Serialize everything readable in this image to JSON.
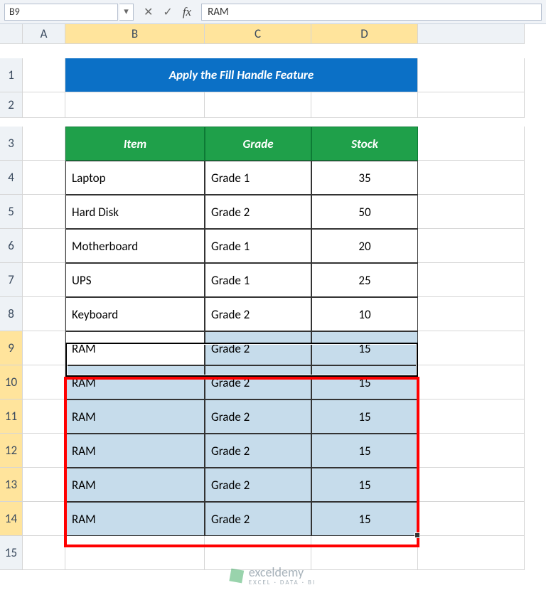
{
  "namebox": {
    "value": "B9"
  },
  "formula_bar": {
    "value": "RAM"
  },
  "columns": {
    "A": "A",
    "B": "B",
    "C": "C",
    "D": "D"
  },
  "rows": {
    "r1": "1",
    "r2": "2",
    "r3": "3",
    "r4": "4",
    "r5": "5",
    "r6": "6",
    "r7": "7",
    "r8": "8",
    "r9": "9",
    "r10": "10",
    "r11": "11",
    "r12": "12",
    "r13": "13",
    "r14": "14",
    "r15": "15"
  },
  "title": "Apply the Fill Handle Feature",
  "table": {
    "headers": {
      "item": "Item",
      "grade": "Grade",
      "stock": "Stock"
    },
    "rows": [
      {
        "item": "Laptop",
        "grade": "Grade 1",
        "stock": "35"
      },
      {
        "item": "Hard Disk",
        "grade": "Grade 2",
        "stock": "50"
      },
      {
        "item": "Motherboard",
        "grade": "Grade 1",
        "stock": "20"
      },
      {
        "item": "UPS",
        "grade": "Grade 1",
        "stock": "25"
      },
      {
        "item": "Keyboard",
        "grade": "Grade 2",
        "stock": "10"
      },
      {
        "item": "RAM",
        "grade": "Grade 2",
        "stock": "15"
      },
      {
        "item": "RAM",
        "grade": "Grade 2",
        "stock": "15"
      },
      {
        "item": "RAM",
        "grade": "Grade 2",
        "stock": "15"
      },
      {
        "item": "RAM",
        "grade": "Grade 2",
        "stock": "15"
      },
      {
        "item": "RAM",
        "grade": "Grade 2",
        "stock": "15"
      },
      {
        "item": "RAM",
        "grade": "Grade 2",
        "stock": "15"
      }
    ]
  },
  "watermark": {
    "brand": "exceldemy",
    "tagline": "EXCEL · DATA · BI"
  },
  "icons": {
    "dropdown": "▾",
    "cancel": "✕",
    "enter": "✓",
    "fx": "fx"
  }
}
